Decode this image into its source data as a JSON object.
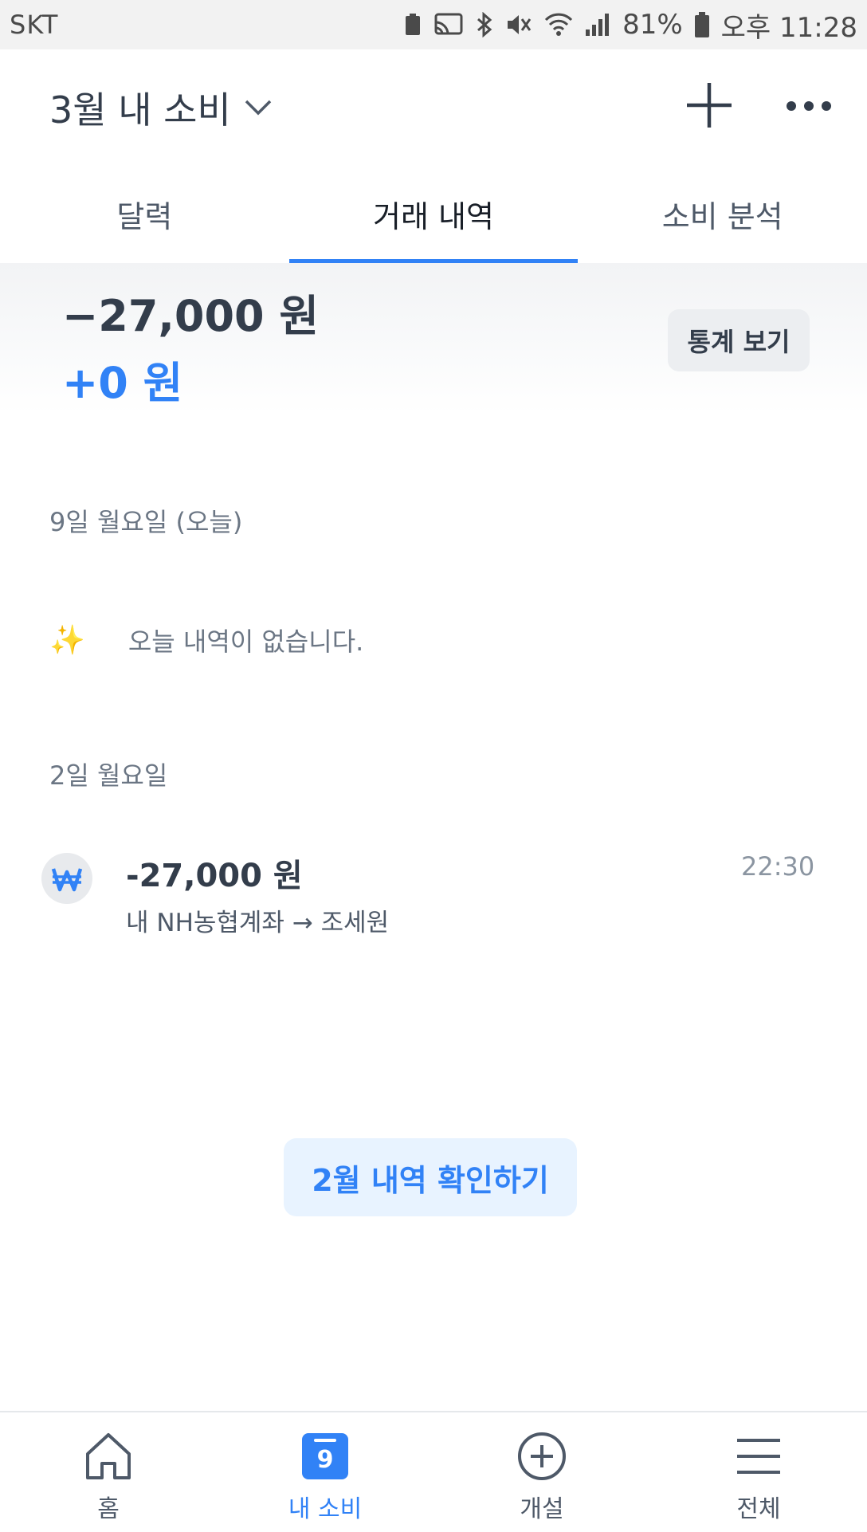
{
  "status_bar": {
    "carrier": "SKT",
    "battery": "81%",
    "time": "오후 11:28"
  },
  "header": {
    "title": "3월 내 소비"
  },
  "tabs": [
    {
      "label": "달력"
    },
    {
      "label": "거래 내역"
    },
    {
      "label": "소비 분석"
    }
  ],
  "summary": {
    "expense_total": "−27,000 원",
    "income_total": "+0 원",
    "stats_button": "통계 보기"
  },
  "sections": [
    {
      "date": "9일 월요일 (오늘)",
      "empty_icon": "✨",
      "empty_text": "오늘 내역이 없습니다."
    },
    {
      "date": "2일 월요일",
      "transactions": [
        {
          "amount": "-27,000 원",
          "description": "내 NH농협계좌 → 조세원",
          "time": "22:30"
        }
      ]
    }
  ],
  "prev_month_button": "2월 내역 확인하기",
  "bottom_nav": [
    {
      "label": "홈"
    },
    {
      "label": "내 소비",
      "badge": "9"
    },
    {
      "label": "개설"
    },
    {
      "label": "전체"
    }
  ],
  "colors": {
    "accent": "#3182f6",
    "text": "#333d4b"
  }
}
